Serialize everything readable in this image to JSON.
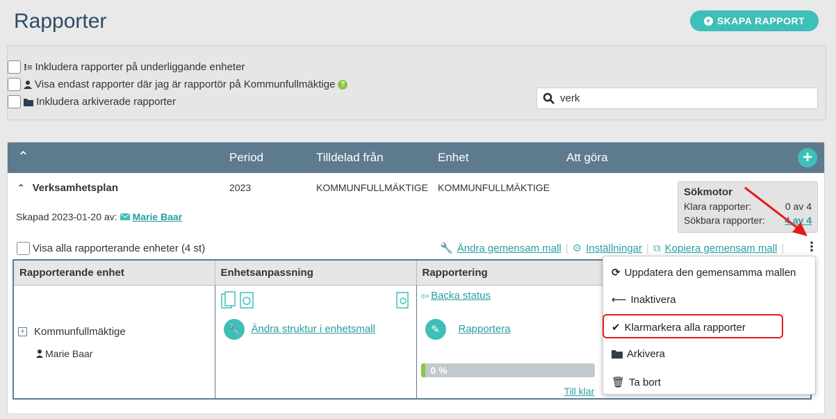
{
  "page": {
    "title": "Rapporter",
    "create_button": "SKAPA RAPPORT"
  },
  "filters": {
    "include_sub": "Inkludera rapporter på underliggande enheter",
    "only_reporter": "Visa endast rapporter där jag är rapportör på Kommunfullmäktige",
    "include_archived": "Inkludera arkiverade rapporter",
    "search_value": "verk"
  },
  "table_header": {
    "period": "Period",
    "assigned_from": "Tilldelad från",
    "unit": "Enhet",
    "todo": "Att göra"
  },
  "report": {
    "name": "Verksamhetsplan",
    "period": "2023",
    "assigned_from": "KOMMUNFULLMÄKTIGE",
    "unit": "KOMMUNFULLMÄKTIGE",
    "created": "Skapad 2023-01-20 av:",
    "creator": "Marie Baar",
    "show_all": "Visa alla rapporterande enheter (4 st)",
    "actions": {
      "edit_template": "Ändra gemensam mall",
      "settings": "Inställningar",
      "copy_template": "Kopiera gemensam mall"
    }
  },
  "search_engine": {
    "title": "Sökmotor",
    "ready_label": "Klara rapporter:",
    "ready_value": "0 av 4",
    "searchable_label": "Sökbara rapporter:",
    "searchable_value": "4 av 4"
  },
  "grid": {
    "headers": [
      "Rapporterande enhet",
      "Enhetsanpassning",
      "Rapportering"
    ],
    "unit_name": "Kommunfullmäktige",
    "reporter": "Marie Baar",
    "edit_structure": "Ändra struktur i enhetsmall",
    "back_status": "Backa status",
    "report_link": "Rapportera",
    "progress_label": "0 %",
    "progress_value": 0,
    "to_done": "Till klar"
  },
  "menu": {
    "update": "Uppdatera den gemensamma mallen",
    "deactivate": "Inaktivera",
    "mark_done": "Klarmarkera alla rapporter",
    "archive": "Arkivera",
    "delete": "Ta bort"
  },
  "colors": {
    "accent": "#3ebfb7",
    "header": "#5d7a8f",
    "highlight": "#e21b1b",
    "arrow": "#e21b1b"
  }
}
